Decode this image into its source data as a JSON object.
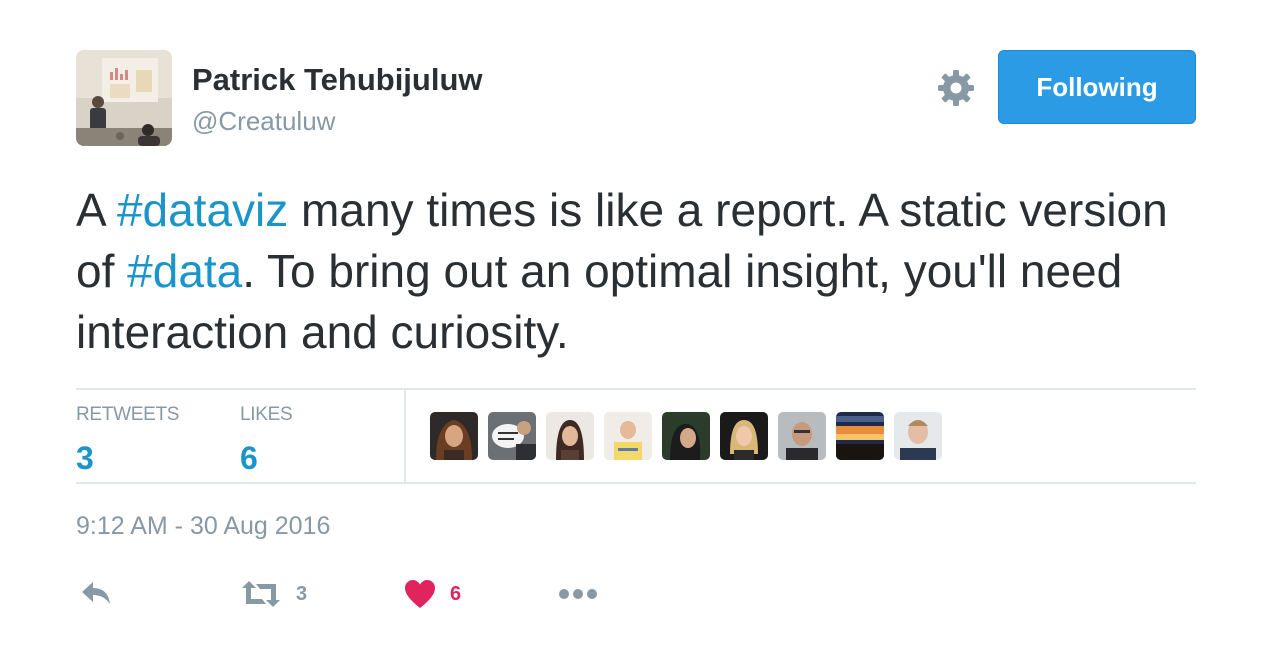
{
  "tweet": {
    "author": {
      "name": "Patrick Tehubijuluw",
      "handle": "@Creatuluw"
    },
    "follow_button": "Following",
    "text": [
      {
        "t": "A ",
        "tag": false
      },
      {
        "t": "#dataviz",
        "tag": true
      },
      {
        "t": " many times is like a report. A static version of ",
        "tag": false
      },
      {
        "t": "#data",
        "tag": true
      },
      {
        "t": ". To bring out an optimal insight, you'll need interaction and curiosity.",
        "tag": false
      }
    ],
    "stats": {
      "retweets_label": "RETWEETS",
      "retweets_count": "3",
      "likes_label": "LIKES",
      "likes_count": "6"
    },
    "liker_avatars": 9,
    "timestamp": "9:12 AM - 30 Aug 2016",
    "actions": {
      "reply_icon": "reply-icon",
      "retweet_icon": "retweet-icon",
      "retweet_count": "3",
      "like_icon": "heart-icon",
      "like_count": "6",
      "more_icon": "more-icon"
    }
  },
  "colors": {
    "accent": "#1b95c9",
    "follow_button": "#2b9be6",
    "like": "#e0245e",
    "muted": "#8899a6",
    "text": "#292f33"
  }
}
